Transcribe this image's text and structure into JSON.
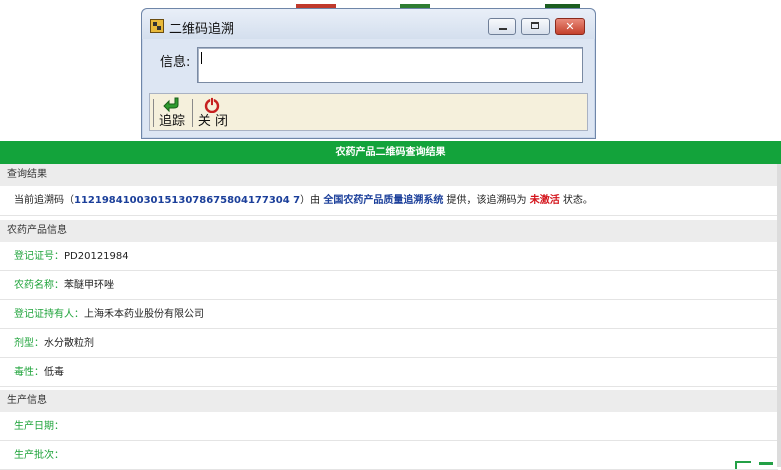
{
  "dialog": {
    "title": "二维码追溯",
    "info_label": "信息:",
    "info_value": "",
    "toolbar": {
      "trace_label": "追踪",
      "close_label": "关 闭"
    }
  },
  "result": {
    "banner_title": "农药产品二维码查询结果",
    "query_section": {
      "title": "查询结果",
      "text_prefix": "当前追溯码（",
      "trace_code": "1121984100301513078675804177304 7",
      "text_mid": "）由",
      "system_name": "全国农药产品质量追溯系统",
      "text_mid2": "提供，该追溯码为",
      "status": "未激活",
      "text_suffix": "状态。"
    },
    "product_section": {
      "title": "农药产品信息",
      "rows": [
        {
          "label": "登记证号：",
          "value": "PD20121984"
        },
        {
          "label": "农药名称：",
          "value": "苯醚甲环唑"
        },
        {
          "label": "登记证持有人：",
          "value": "上海禾本药业股份有限公司"
        },
        {
          "label": "剂型：",
          "value": "水分散粒剂"
        },
        {
          "label": "毒性：",
          "value": "低毒"
        }
      ]
    },
    "production_section": {
      "title": "生产信息",
      "rows": [
        {
          "label": "生产日期：",
          "value": ""
        },
        {
          "label": "生产批次：",
          "value": ""
        }
      ]
    }
  },
  "colors": {
    "banner": "#13a33b",
    "label_green": "#1ea33a",
    "code_blue": "#1b3f9a",
    "status_red": "#d4141b"
  }
}
